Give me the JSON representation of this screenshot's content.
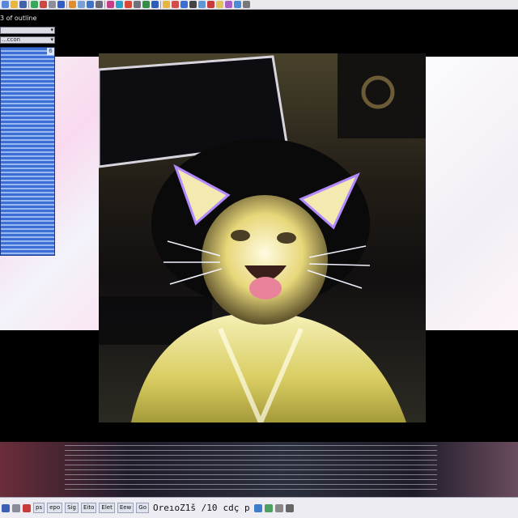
{
  "toolbar": {
    "icons": [
      "nav-icon",
      "folder-icon",
      "save-icon",
      "refresh-icon",
      "stop-icon",
      "home-icon",
      "search-icon",
      "bookmark-icon",
      "history-icon",
      "mail-icon",
      "print-icon",
      "edit-icon",
      "chat-icon",
      "media-icon",
      "settings-icon",
      "tools-icon",
      "help-icon"
    ]
  },
  "sidebar": {
    "title": "3 of outline",
    "select_1": "",
    "select_2": "...ccon",
    "panel_cap": "6"
  },
  "taskbar": {
    "labels": [
      "ps",
      "epo",
      "Sig",
      "Eito",
      "Elet",
      "Eew",
      "Go"
    ],
    "clock": "OreıoZ1š /10",
    "extra": "cdç p"
  },
  "colors": {
    "toolbar_bg": "#e9e9ee",
    "side_panel": "#3b6fd6",
    "taskbar_bg": "#ececf2"
  }
}
